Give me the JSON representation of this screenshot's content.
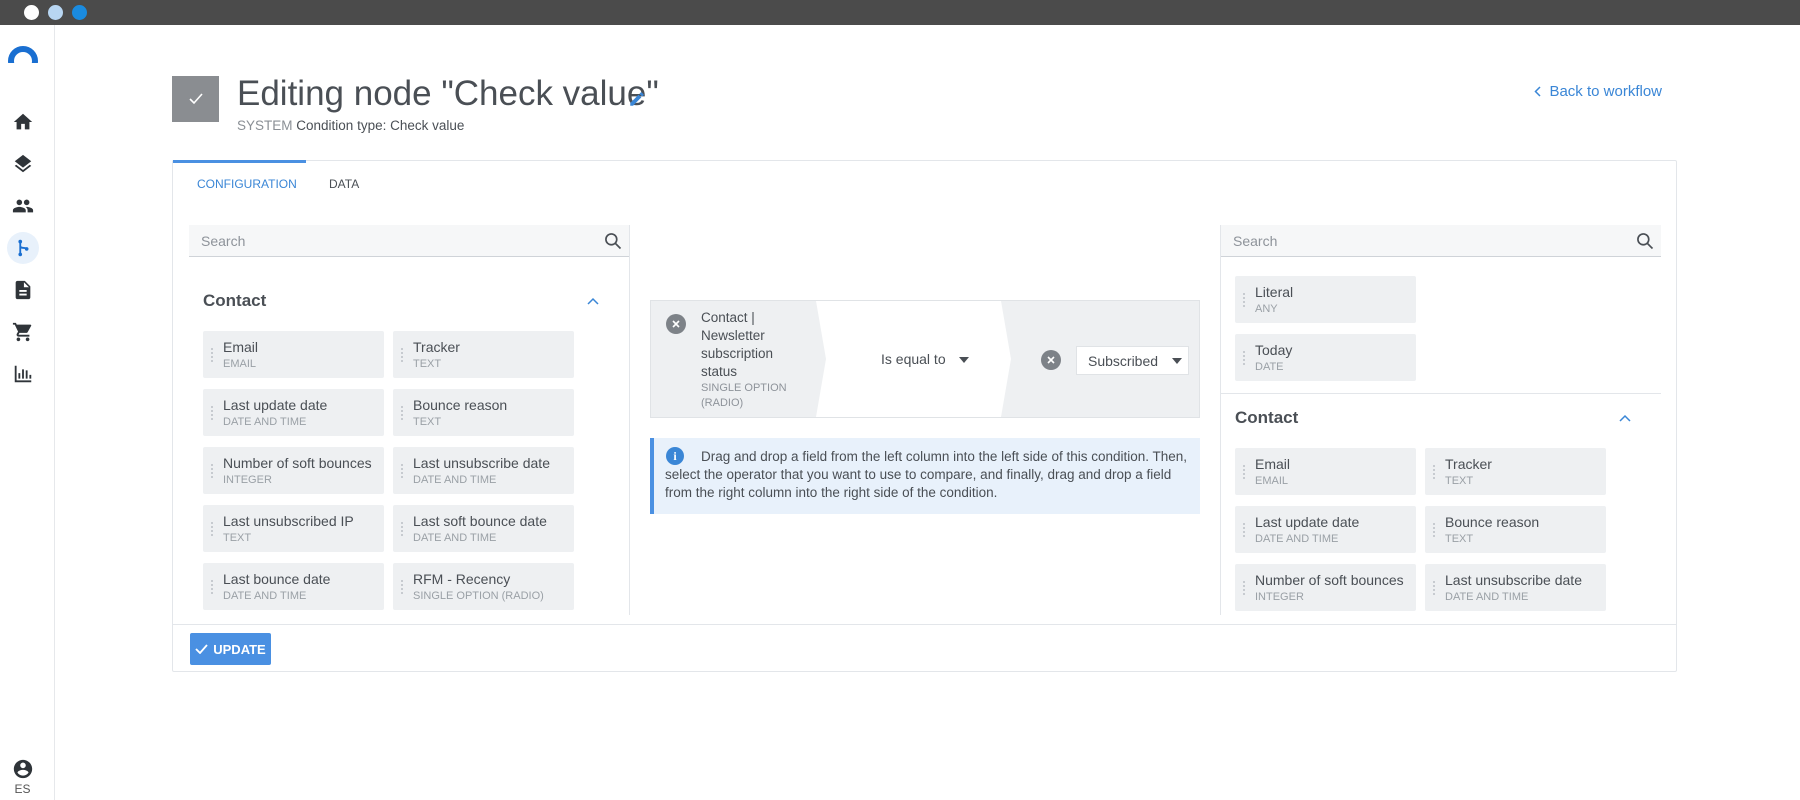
{
  "sidebar": {
    "items": [
      {
        "icon": "home-icon",
        "active": false
      },
      {
        "icon": "layers-icon",
        "active": false
      },
      {
        "icon": "contacts-icon",
        "active": false
      },
      {
        "icon": "workflow-icon",
        "active": true
      },
      {
        "icon": "document-icon",
        "active": false
      },
      {
        "icon": "cart-icon",
        "active": false
      },
      {
        "icon": "chart-icon",
        "active": false
      }
    ],
    "language": "ES"
  },
  "header": {
    "title": "Editing node \"Check value\"",
    "system_label": "SYSTEM",
    "subtitle": "Condition type: Check value",
    "back_link": "Back to workflow"
  },
  "tabs": [
    {
      "label": "CONFIGURATION",
      "active": true
    },
    {
      "label": "DATA",
      "active": false
    }
  ],
  "left_panel": {
    "search_placeholder": "Search",
    "section_title": "Contact",
    "fields": [
      {
        "name": "Email",
        "type": "EMAIL"
      },
      {
        "name": "Tracker",
        "type": "TEXT"
      },
      {
        "name": "Last update date",
        "type": "DATE AND TIME"
      },
      {
        "name": "Bounce reason",
        "type": "TEXT"
      },
      {
        "name": "Number of soft bounces",
        "type": "INTEGER"
      },
      {
        "name": "Last unsubscribe date",
        "type": "DATE AND TIME"
      },
      {
        "name": "Last unsubscribed IP",
        "type": "TEXT"
      },
      {
        "name": "Last soft bounce date",
        "type": "DATE AND TIME"
      },
      {
        "name": "Last bounce date",
        "type": "DATE AND TIME"
      },
      {
        "name": "RFM - Recency",
        "type": "SINGLE OPTION (RADIO)"
      }
    ]
  },
  "condition": {
    "field_name": "Contact | Newsletter subscription status",
    "field_type": "SINGLE OPTION (RADIO)",
    "operator": "Is equal to",
    "value": "Subscribed",
    "info": "Drag and drop a field from the left column into the left side of this condition. Then, select the operator that you want to use to compare, and finally, drag and drop a field from the right column into the right side of the condition."
  },
  "right_panel": {
    "search_placeholder": "Search",
    "special_fields": [
      {
        "name": "Literal",
        "type": "ANY"
      },
      {
        "name": "Today",
        "type": "DATE"
      }
    ],
    "section_title": "Contact",
    "fields": [
      {
        "name": "Email",
        "type": "EMAIL"
      },
      {
        "name": "Tracker",
        "type": "TEXT"
      },
      {
        "name": "Last update date",
        "type": "DATE AND TIME"
      },
      {
        "name": "Bounce reason",
        "type": "TEXT"
      },
      {
        "name": "Number of soft bounces",
        "type": "INTEGER"
      },
      {
        "name": "Last unsubscribe date",
        "type": "DATE AND TIME"
      }
    ]
  },
  "footer": {
    "update_label": "UPDATE"
  },
  "colors": {
    "accent": "#4a90e2",
    "link": "#3a86d6",
    "titlebar": "#4b4b4b"
  }
}
